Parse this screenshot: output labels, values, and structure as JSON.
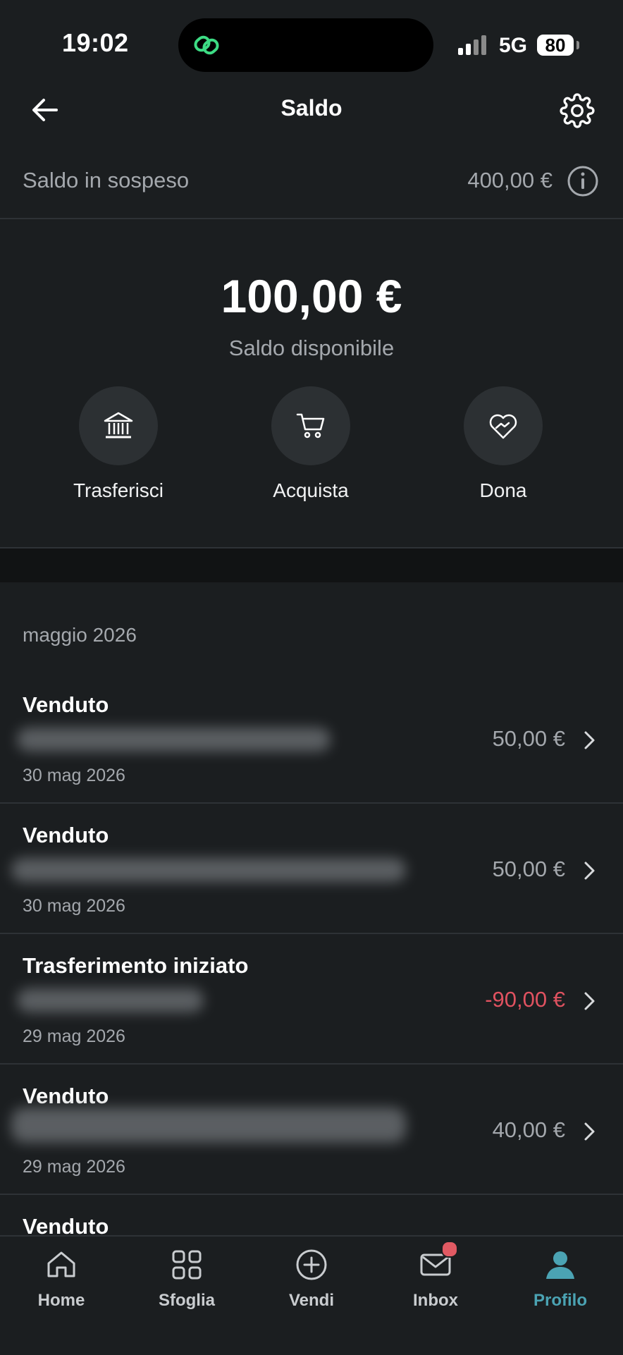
{
  "status_bar": {
    "time": "19:02",
    "network": "5G",
    "battery": "80"
  },
  "header": {
    "title": "Saldo"
  },
  "pending": {
    "label": "Saldo in sospeso",
    "value": "400,00 €"
  },
  "balance": {
    "amount": "100,00 €",
    "label": "Saldo disponibile"
  },
  "actions": [
    {
      "label": "Trasferisci",
      "icon": "bank-icon"
    },
    {
      "label": "Acquista",
      "icon": "cart-icon"
    },
    {
      "label": "Dona",
      "icon": "heart-hands-icon"
    }
  ],
  "month": "maggio 2026",
  "transactions": [
    {
      "title": "Venduto",
      "date": "30 mag 2026",
      "amount": "50,00 €",
      "negative": false
    },
    {
      "title": "Venduto",
      "date": "30 mag 2026",
      "amount": "50,00 €",
      "negative": false
    },
    {
      "title": "Trasferimento iniziato",
      "date": "29 mag 2026",
      "amount": "-90,00 €",
      "negative": true
    },
    {
      "title": "Venduto",
      "date": "29 mag 2026",
      "amount": "40,00 €",
      "negative": false
    },
    {
      "title": "Venduto"
    }
  ],
  "tabs": [
    {
      "label": "Home",
      "icon": "home-icon"
    },
    {
      "label": "Sfoglia",
      "icon": "grid-icon"
    },
    {
      "label": "Vendi",
      "icon": "plus-circle-icon"
    },
    {
      "label": "Inbox",
      "icon": "mail-icon"
    },
    {
      "label": "Profilo",
      "icon": "profile-icon",
      "active": true
    }
  ],
  "colors": {
    "background": "#1b1e20",
    "accent": "#4ba3b3",
    "negative": "#e05260",
    "muted": "#a4a8ad",
    "badge": "#e15a63"
  }
}
